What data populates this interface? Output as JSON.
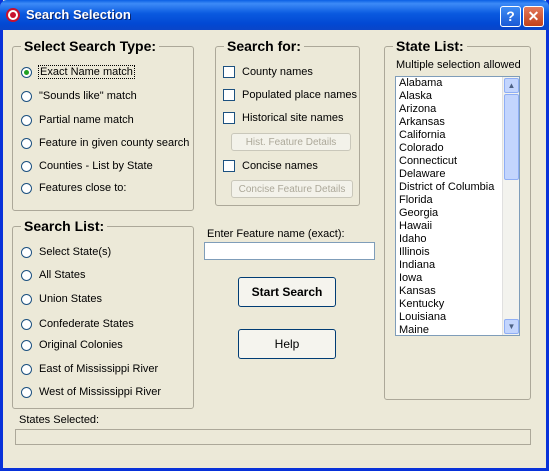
{
  "window": {
    "title": "Search Selection",
    "help_button": "?",
    "close_button": "✕"
  },
  "search_type": {
    "title": "Select Search Type:",
    "options": [
      {
        "label": "Exact Name match",
        "checked": true
      },
      {
        "label": "\"Sounds like\" match",
        "checked": false
      },
      {
        "label": "Partial name match",
        "checked": false
      },
      {
        "label": "Feature in given county search",
        "checked": false
      },
      {
        "label": "Counties - List by State",
        "checked": false
      },
      {
        "label": "Features close to:",
        "checked": false
      }
    ]
  },
  "search_for": {
    "title": "Search for:",
    "county_names": "County names",
    "populated_place_names": "Populated place names",
    "historical_site_names": "Historical site names",
    "hist_feature_details": "Hist. Feature Details",
    "concise_names": "Concise names",
    "concise_feature_details": "Concise Feature Details"
  },
  "state_list": {
    "title": "State List:",
    "hint": "Multiple selection allowed",
    "states": [
      "Alabama",
      "Alaska",
      "Arizona",
      "Arkansas",
      "California",
      "Colorado",
      "Connecticut",
      "Delaware",
      "District of Columbia",
      "Florida",
      "Georgia",
      "Hawaii",
      "Idaho",
      "Illinois",
      "Indiana",
      "Iowa",
      "Kansas",
      "Kentucky",
      "Louisiana",
      "Maine"
    ],
    "scroll_up": "▲",
    "scroll_down": "▼"
  },
  "search_list": {
    "title": "Search List:",
    "options": [
      {
        "label": "Select State(s)",
        "checked": false
      },
      {
        "label": "All States",
        "checked": false
      },
      {
        "label": "Union States",
        "checked": false
      },
      {
        "label": "Confederate States",
        "checked": false
      },
      {
        "label": "Original Colonies",
        "checked": false
      },
      {
        "label": "East of Mississippi River",
        "checked": false
      },
      {
        "label": "West of Mississippi River",
        "checked": false
      }
    ]
  },
  "feature_input": {
    "label": "Enter Feature name (exact):",
    "value": ""
  },
  "actions": {
    "start_search": "Start Search",
    "help": "Help"
  },
  "status": {
    "label": "States Selected:",
    "value": ""
  }
}
